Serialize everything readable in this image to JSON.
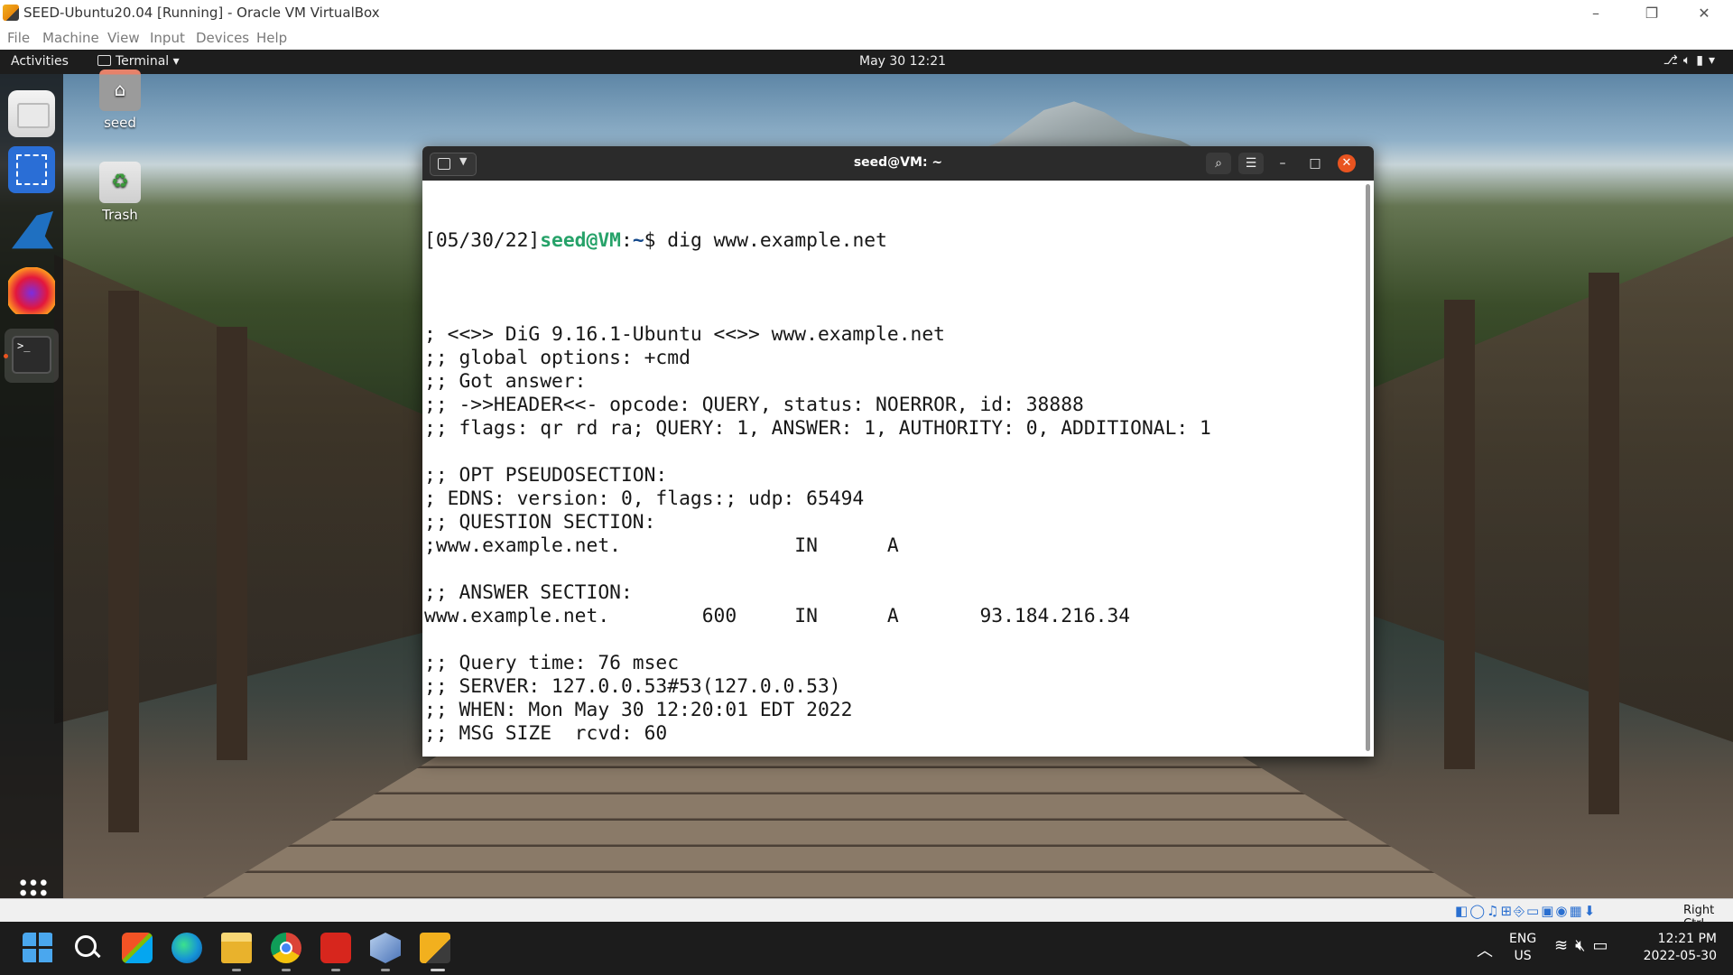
{
  "vbox": {
    "title": "SEED-Ubuntu20.04 [Running] - Oracle VM VirtualBox",
    "menu": [
      "File",
      "Machine",
      "View",
      "Input",
      "Devices",
      "Help"
    ],
    "host_key": "Right Ctrl"
  },
  "gnome": {
    "activities": "Activities",
    "app_menu": "Terminal",
    "clock": "May 30  12:21",
    "status_icons": [
      "network-icon",
      "volume-icon",
      "battery-icon",
      "chevron-down-icon"
    ]
  },
  "desktop": {
    "icons": [
      {
        "label": "seed",
        "icon": "home-folder-icon"
      },
      {
        "label": "Trash",
        "icon": "trash-icon"
      }
    ]
  },
  "dock": {
    "items": [
      "files-icon",
      "screenshot-icon",
      "wireshark-icon",
      "firefox-icon",
      "terminal-icon",
      "show-apps-icon"
    ],
    "running": "terminal-icon"
  },
  "terminal": {
    "title": "seed@VM: ~",
    "prompt": {
      "date": "[05/30/22]",
      "user": "seed@VM",
      "sep": ":",
      "path": "~",
      "sigil": "$ "
    },
    "command": "dig www.example.net",
    "output": [
      "",
      "; <<>> DiG 9.16.1-Ubuntu <<>> www.example.net",
      ";; global options: +cmd",
      ";; Got answer:",
      ";; ->>HEADER<<- opcode: QUERY, status: NOERROR, id: 38888",
      ";; flags: qr rd ra; QUERY: 1, ANSWER: 1, AUTHORITY: 0, ADDITIONAL: 1",
      "",
      ";; OPT PSEUDOSECTION:",
      "; EDNS: version: 0, flags:; udp: 65494",
      ";; QUESTION SECTION:",
      ";www.example.net.               IN      A",
      "",
      ";; ANSWER SECTION:",
      "www.example.net.        600     IN      A       93.184.216.34",
      "",
      ";; Query time: 76 msec",
      ";; SERVER: 127.0.0.53#53(127.0.0.53)",
      ";; WHEN: Mon May 30 12:20:01 EDT 2022",
      ";; MSG SIZE  rcvd: 60",
      ""
    ]
  },
  "taskbar": {
    "apps": [
      "start-icon",
      "search-icon",
      "store-icon",
      "edge-icon",
      "file-explorer-icon",
      "chrome-icon",
      "acrobat-icon",
      "virtualbox-icon",
      "virtualbox-vm-icon"
    ],
    "lang_top": "ENG",
    "lang_bottom": "US",
    "time": "12:21 PM",
    "date": "2022-05-30"
  },
  "colors": {
    "prompt_user": "#26a269",
    "prompt_path": "#12488b",
    "accent_close": "#e95420"
  }
}
